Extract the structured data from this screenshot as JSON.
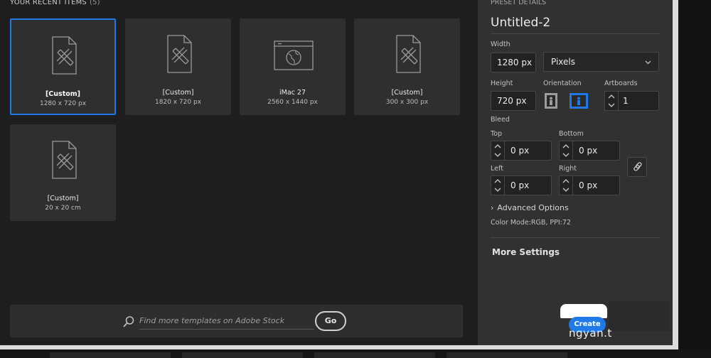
{
  "recent": {
    "title": "YOUR RECENT ITEMS",
    "count": "(5)",
    "items": [
      {
        "name": "[Custom]",
        "size": "1280 x 720 px",
        "icon": "document-pencil-icon",
        "selected": true
      },
      {
        "name": "[Custom]",
        "size": "1820 x 720 px",
        "icon": "document-pencil-icon",
        "selected": false
      },
      {
        "name": "iMac 27",
        "size": "2560 x 1440 px",
        "icon": "web-browser-icon",
        "selected": false
      },
      {
        "name": "[Custom]",
        "size": "300 x 300 px",
        "icon": "document-pencil-icon",
        "selected": false
      },
      {
        "name": "[Custom]",
        "size": "20 x 20 cm",
        "icon": "document-pencil-icon",
        "selected": false
      }
    ]
  },
  "search": {
    "placeholder": "Find more templates on Adobe Stock",
    "go_label": "Go"
  },
  "preset": {
    "section_title": "PRESET DETAILS",
    "doc_name": "Untitled-2",
    "width_label": "Width",
    "width_value": "1280 px",
    "units_value": "Pixels",
    "height_label": "Height",
    "height_value": "720 px",
    "orientation_label": "Orientation",
    "artboards_label": "Artboards",
    "artboards_value": "1",
    "bleed_label": "Bleed",
    "top_label": "Top",
    "top_value": "0 px",
    "bottom_label": "Bottom",
    "bottom_value": "0 px",
    "left_label": "Left",
    "left_value": "0 px",
    "right_label": "Right",
    "right_value": "0 px",
    "advanced_label": "Advanced Options",
    "color_mode": "Color Mode:RGB, PPI:72",
    "more_settings": "More Settings",
    "create_label": "Create",
    "watermark_text": "ngyan.t"
  },
  "colors": {
    "accent": "#1f7ae8",
    "panel": "#313131",
    "background": "#1e1e1e"
  }
}
